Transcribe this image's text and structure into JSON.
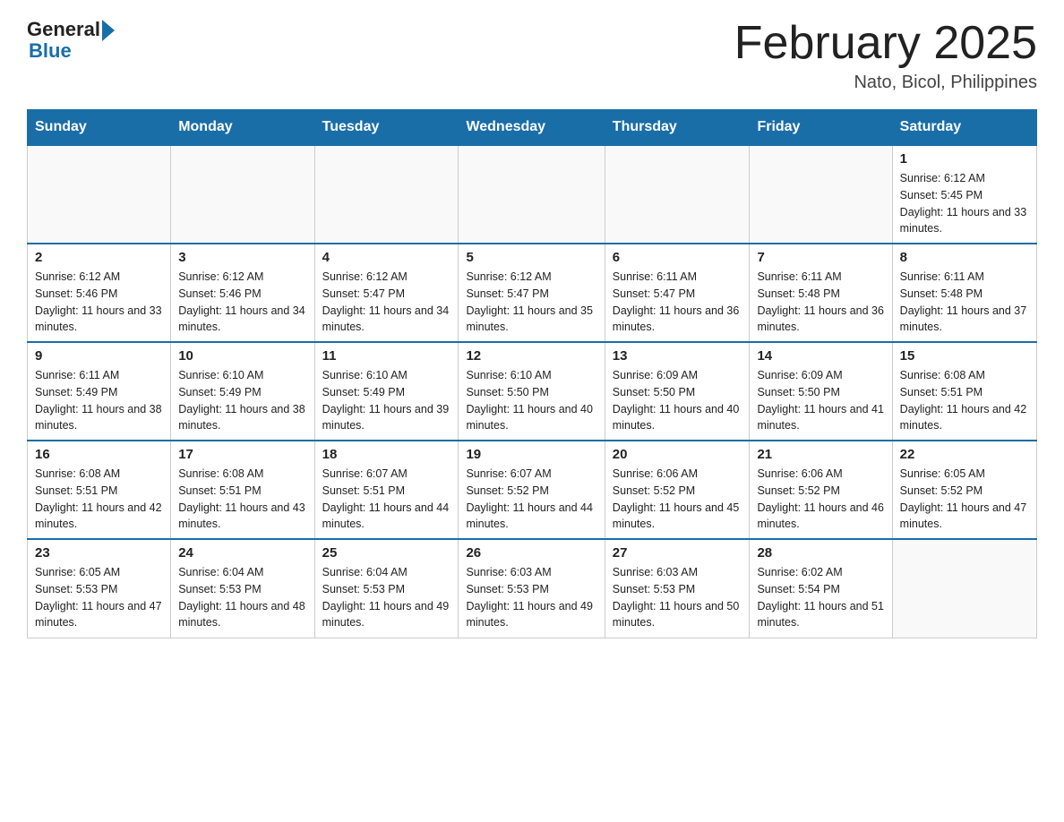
{
  "header": {
    "logo_general": "General",
    "logo_blue": "Blue",
    "month_title": "February 2025",
    "location": "Nato, Bicol, Philippines"
  },
  "days_of_week": [
    "Sunday",
    "Monday",
    "Tuesday",
    "Wednesday",
    "Thursday",
    "Friday",
    "Saturday"
  ],
  "weeks": [
    {
      "days": [
        {
          "date": "",
          "info": ""
        },
        {
          "date": "",
          "info": ""
        },
        {
          "date": "",
          "info": ""
        },
        {
          "date": "",
          "info": ""
        },
        {
          "date": "",
          "info": ""
        },
        {
          "date": "",
          "info": ""
        },
        {
          "date": "1",
          "info": "Sunrise: 6:12 AM\nSunset: 5:45 PM\nDaylight: 11 hours and 33 minutes."
        }
      ]
    },
    {
      "days": [
        {
          "date": "2",
          "info": "Sunrise: 6:12 AM\nSunset: 5:46 PM\nDaylight: 11 hours and 33 minutes."
        },
        {
          "date": "3",
          "info": "Sunrise: 6:12 AM\nSunset: 5:46 PM\nDaylight: 11 hours and 34 minutes."
        },
        {
          "date": "4",
          "info": "Sunrise: 6:12 AM\nSunset: 5:47 PM\nDaylight: 11 hours and 34 minutes."
        },
        {
          "date": "5",
          "info": "Sunrise: 6:12 AM\nSunset: 5:47 PM\nDaylight: 11 hours and 35 minutes."
        },
        {
          "date": "6",
          "info": "Sunrise: 6:11 AM\nSunset: 5:47 PM\nDaylight: 11 hours and 36 minutes."
        },
        {
          "date": "7",
          "info": "Sunrise: 6:11 AM\nSunset: 5:48 PM\nDaylight: 11 hours and 36 minutes."
        },
        {
          "date": "8",
          "info": "Sunrise: 6:11 AM\nSunset: 5:48 PM\nDaylight: 11 hours and 37 minutes."
        }
      ]
    },
    {
      "days": [
        {
          "date": "9",
          "info": "Sunrise: 6:11 AM\nSunset: 5:49 PM\nDaylight: 11 hours and 38 minutes."
        },
        {
          "date": "10",
          "info": "Sunrise: 6:10 AM\nSunset: 5:49 PM\nDaylight: 11 hours and 38 minutes."
        },
        {
          "date": "11",
          "info": "Sunrise: 6:10 AM\nSunset: 5:49 PM\nDaylight: 11 hours and 39 minutes."
        },
        {
          "date": "12",
          "info": "Sunrise: 6:10 AM\nSunset: 5:50 PM\nDaylight: 11 hours and 40 minutes."
        },
        {
          "date": "13",
          "info": "Sunrise: 6:09 AM\nSunset: 5:50 PM\nDaylight: 11 hours and 40 minutes."
        },
        {
          "date": "14",
          "info": "Sunrise: 6:09 AM\nSunset: 5:50 PM\nDaylight: 11 hours and 41 minutes."
        },
        {
          "date": "15",
          "info": "Sunrise: 6:08 AM\nSunset: 5:51 PM\nDaylight: 11 hours and 42 minutes."
        }
      ]
    },
    {
      "days": [
        {
          "date": "16",
          "info": "Sunrise: 6:08 AM\nSunset: 5:51 PM\nDaylight: 11 hours and 42 minutes."
        },
        {
          "date": "17",
          "info": "Sunrise: 6:08 AM\nSunset: 5:51 PM\nDaylight: 11 hours and 43 minutes."
        },
        {
          "date": "18",
          "info": "Sunrise: 6:07 AM\nSunset: 5:51 PM\nDaylight: 11 hours and 44 minutes."
        },
        {
          "date": "19",
          "info": "Sunrise: 6:07 AM\nSunset: 5:52 PM\nDaylight: 11 hours and 44 minutes."
        },
        {
          "date": "20",
          "info": "Sunrise: 6:06 AM\nSunset: 5:52 PM\nDaylight: 11 hours and 45 minutes."
        },
        {
          "date": "21",
          "info": "Sunrise: 6:06 AM\nSunset: 5:52 PM\nDaylight: 11 hours and 46 minutes."
        },
        {
          "date": "22",
          "info": "Sunrise: 6:05 AM\nSunset: 5:52 PM\nDaylight: 11 hours and 47 minutes."
        }
      ]
    },
    {
      "days": [
        {
          "date": "23",
          "info": "Sunrise: 6:05 AM\nSunset: 5:53 PM\nDaylight: 11 hours and 47 minutes."
        },
        {
          "date": "24",
          "info": "Sunrise: 6:04 AM\nSunset: 5:53 PM\nDaylight: 11 hours and 48 minutes."
        },
        {
          "date": "25",
          "info": "Sunrise: 6:04 AM\nSunset: 5:53 PM\nDaylight: 11 hours and 49 minutes."
        },
        {
          "date": "26",
          "info": "Sunrise: 6:03 AM\nSunset: 5:53 PM\nDaylight: 11 hours and 49 minutes."
        },
        {
          "date": "27",
          "info": "Sunrise: 6:03 AM\nSunset: 5:53 PM\nDaylight: 11 hours and 50 minutes."
        },
        {
          "date": "28",
          "info": "Sunrise: 6:02 AM\nSunset: 5:54 PM\nDaylight: 11 hours and 51 minutes."
        },
        {
          "date": "",
          "info": ""
        }
      ]
    }
  ]
}
